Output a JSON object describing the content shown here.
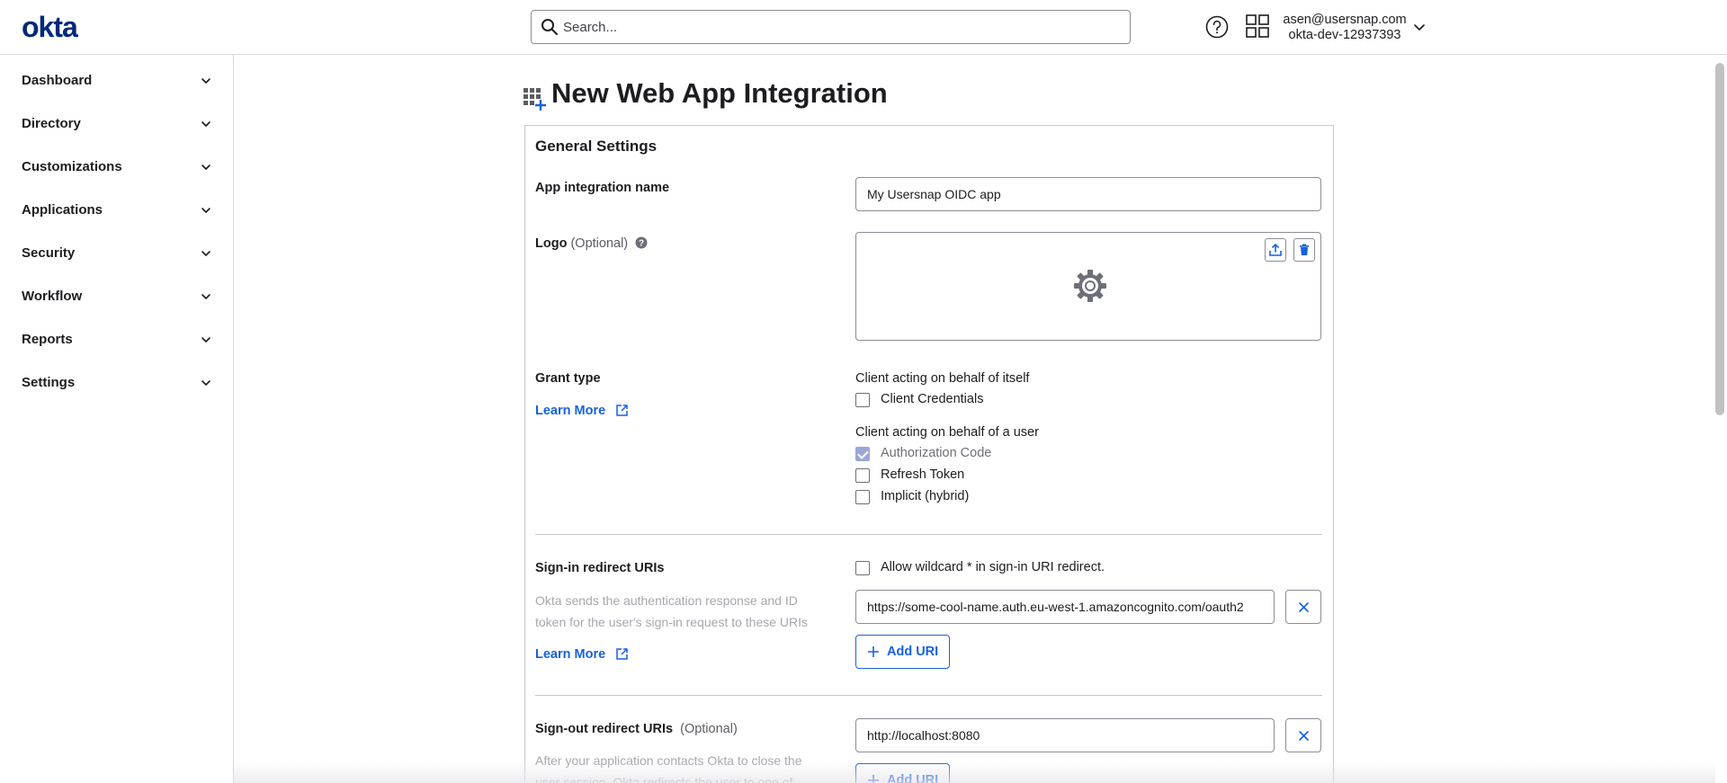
{
  "brand": {
    "logo_text": "okta",
    "color": "#00297a"
  },
  "header": {
    "search_placeholder": "Search...",
    "help_icon": "help-circle-icon",
    "apps_icon": "app-grid-icon",
    "user_email": "asen@usersnap.com",
    "org_name": "okta-dev-12937393"
  },
  "sidebar": {
    "items": [
      {
        "label": "Dashboard"
      },
      {
        "label": "Directory"
      },
      {
        "label": "Customizations"
      },
      {
        "label": "Applications"
      },
      {
        "label": "Security"
      },
      {
        "label": "Workflow"
      },
      {
        "label": "Reports"
      },
      {
        "label": "Settings"
      }
    ]
  },
  "page": {
    "title": "New Web App Integration",
    "section_title": "General Settings",
    "app_name": {
      "label": "App integration name",
      "value": "My Usersnap OIDC app"
    },
    "logo": {
      "label": "Logo",
      "optional": "(Optional)",
      "icon": "gear-icon"
    },
    "grant_type": {
      "label": "Grant type",
      "learn_more": "Learn More",
      "group1_title": "Client acting on behalf of itself",
      "group1_options": [
        {
          "label": "Client Credentials",
          "checked": false
        }
      ],
      "group2_title": "Client acting on behalf of a user",
      "group2_options": [
        {
          "label": "Authorization Code",
          "checked": true,
          "disabled": true
        },
        {
          "label": "Refresh Token",
          "checked": false
        },
        {
          "label": "Implicit (hybrid)",
          "checked": false
        }
      ]
    },
    "signin_redirect": {
      "label": "Sign-in redirect URIs",
      "description": "Okta sends the authentication response and ID token for the user's sign-in request to these URIs",
      "learn_more": "Learn More",
      "wildcard_label": "Allow wildcard * in sign-in URI redirect.",
      "wildcard_checked": false,
      "uri_value": "https://some-cool-name.auth.eu-west-1.amazoncognito.com/oauth2",
      "add_uri": "Add URI"
    },
    "signout_redirect": {
      "label": "Sign-out redirect URIs",
      "optional": "(Optional)",
      "description": "After your application contacts Okta to close the user session, Okta redirects the user to one of",
      "uri_value": "http://localhost:8080",
      "add_uri": "Add URI"
    }
  },
  "colors": {
    "link": "#1662dd",
    "border": "#8c8c96",
    "text": "#1d1d21"
  }
}
